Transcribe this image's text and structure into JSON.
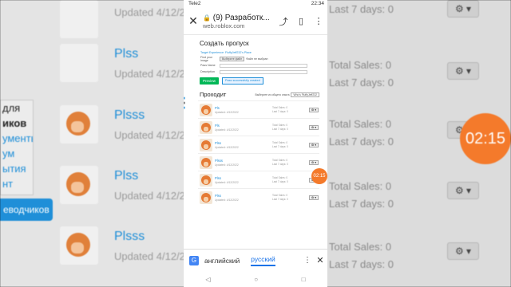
{
  "status_bar": {
    "carrier": "Tele2",
    "time": "22:34"
  },
  "browser": {
    "page_title": "(9) Разработк...",
    "url": "web.roblox.com"
  },
  "page": {
    "heading": "Создать пропуск",
    "form": {
      "target_label": "Target Experience: FluffyJeff232's Place",
      "image_label": "Find your image",
      "image_button": "Выберите файл",
      "image_status": "Файл не выбран",
      "name_label": "Pass Name",
      "description_label": "Description"
    },
    "preview_button": "Preview",
    "verify_button": "Pass successfully created",
    "list_heading": "Проходит",
    "filter_label": "Выберите из общего опыта",
    "filter_value": "Who's FluffyJeff232",
    "items": [
      {
        "name": "Pls",
        "date": "Updated: 4/12/2022",
        "sales": "Total Sales: 0",
        "sales7": "Last 7 days: 0"
      },
      {
        "name": "Pls",
        "date": "Updated: 4/12/2022",
        "sales": "Total Sales: 0",
        "sales7": "Last 7 days: 0"
      },
      {
        "name": "Plss",
        "date": "Updated: 4/12/2022",
        "sales": "Total Sales: 0",
        "sales7": "Last 7 days: 0"
      },
      {
        "name": "Plsss",
        "date": "Updated: 4/12/2022",
        "sales": "Total Sales: 0",
        "sales7": "Last 7 days: 0"
      },
      {
        "name": "Plss",
        "date": "Updated: 4/12/2022",
        "sales": "Total Sales: 0",
        "sales7": "Last 7 days: 0"
      },
      {
        "name": "Plss",
        "date": "Updated: 4/12/2022",
        "sales": "Total Sales: 0",
        "sales7": "Last 7 days: 0"
      }
    ],
    "gear_label": "⚙ ▾"
  },
  "timer_small": "02:15",
  "timer_big": "02:15",
  "translate_bar": {
    "source_lang": "английский",
    "target_lang": "русский"
  },
  "background": {
    "rows": [
      {
        "name": "",
        "updated": "Updated 4/12/2022"
      },
      {
        "name": "Plss",
        "updated": "Updated 4/12/2022"
      },
      {
        "name": "Plsss",
        "updated": "Updated 4/12/2022"
      },
      {
        "name": "Plss",
        "updated": "Updated 4/12/2022"
      },
      {
        "name": "Plsss",
        "updated": "Updated 4/12/2022"
      },
      {
        "name": "Plss",
        "updated": "Updated 4/12/2022"
      }
    ],
    "sales_total": "Total Sales: 0",
    "sales_7": "Last 7 days: 0",
    "sidebar": [
      "для",
      "иков",
      "ументы",
      "ум",
      "ытия",
      "нт"
    ],
    "sidebar_button": "еводчиков"
  }
}
